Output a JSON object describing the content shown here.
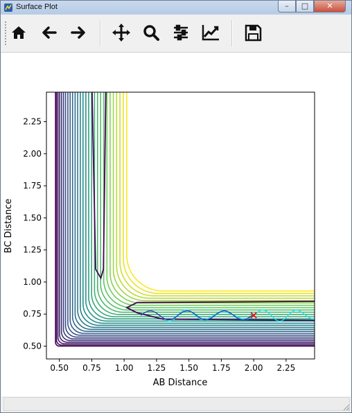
{
  "window": {
    "title": "Surface Plot"
  },
  "title_controls": {
    "minimize": "–",
    "maximize": "□",
    "close": "✕"
  },
  "toolbar": {
    "buttons": [
      {
        "name": "home-icon"
      },
      {
        "name": "back-arrow-icon"
      },
      {
        "name": "forward-arrow-icon"
      },
      {
        "name": "pan-move-icon"
      },
      {
        "name": "zoom-magnifier-icon"
      },
      {
        "name": "subplots-sliders-icon"
      },
      {
        "name": "edit-curves-icon"
      },
      {
        "name": "save-floppy-icon"
      }
    ]
  },
  "chart_data": {
    "type": "contour",
    "xlabel": "AB Distance",
    "ylabel": "BC Distance",
    "xlim": [
      0.4,
      2.47
    ],
    "ylim": [
      0.4,
      2.48
    ],
    "xticks": [
      "0.50",
      "0.75",
      "1.00",
      "1.25",
      "1.50",
      "1.75",
      "2.00",
      "2.25"
    ],
    "yticks": [
      "0.50",
      "0.75",
      "1.00",
      "1.25",
      "1.50",
      "1.75",
      "2.00",
      "2.25"
    ],
    "colormap": [
      "#440154",
      "#3b528b",
      "#21918c",
      "#5ec962",
      "#fde725"
    ],
    "marker": {
      "type": "x",
      "color": "#e41a1c",
      "x": 2.0,
      "y": 0.74
    },
    "trajectory_colors": [
      "#1f3fb8",
      "#19e6e6"
    ]
  }
}
